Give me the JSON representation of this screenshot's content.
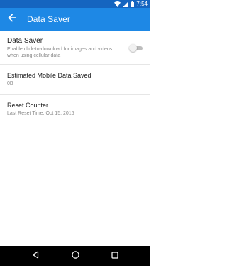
{
  "status_bar": {
    "time": "7:54",
    "icons": [
      "wifi-icon",
      "signal-icon",
      "battery-icon"
    ]
  },
  "app_bar": {
    "title": "Data Saver",
    "back_icon": "back-arrow-icon",
    "background_color": "#1e88e5",
    "status_color": "#1565c0"
  },
  "settings": [
    {
      "title": "Data Saver",
      "subtitle": "Enable click-to-download for images and videos when using cellular data",
      "toggle": {
        "on": false
      }
    },
    {
      "title": "Estimated Mobile Data Saved",
      "subtitle": "0B"
    },
    {
      "title": "Reset Counter",
      "subtitle": "Last Reset Time: Oct 15, 2016"
    }
  ],
  "nav_bar": {
    "buttons": [
      "back-triangle-icon",
      "home-circle-icon",
      "recents-square-icon"
    ]
  }
}
